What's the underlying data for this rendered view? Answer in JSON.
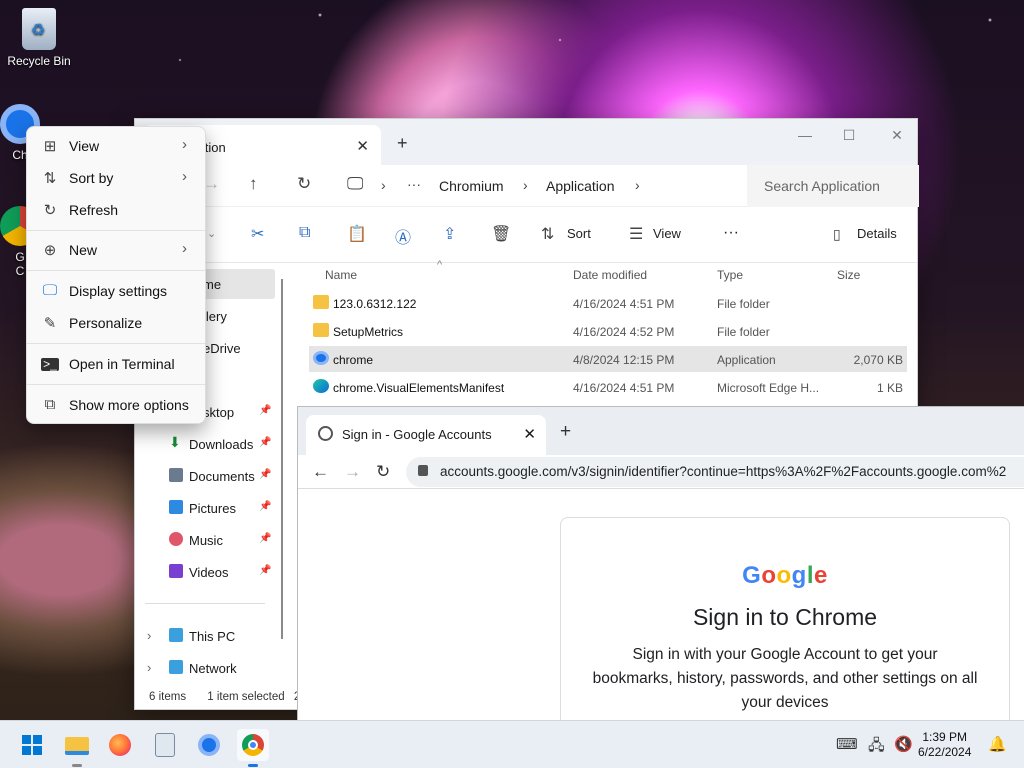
{
  "desktop": {
    "icons": [
      {
        "label": "Recycle Bin"
      },
      {
        "label": "Ch"
      },
      {
        "label": "G"
      },
      {
        "label": "C"
      }
    ]
  },
  "explorer": {
    "tab_title": "Application",
    "tab_title_visible": "cation",
    "breadcrumb": [
      "Chromium",
      "Application"
    ],
    "search_placeholder": "Search Application",
    "toolbar": {
      "sort": "Sort",
      "view": "View",
      "details": "Details"
    },
    "sidebar": [
      {
        "label": "me",
        "selected": true
      },
      {
        "label": "llery"
      },
      {
        "label": "eDrive"
      },
      {
        "label": "sktop",
        "pinned": true
      },
      {
        "label": "Downloads",
        "pinned": true
      },
      {
        "label": "Documents",
        "pinned": true
      },
      {
        "label": "Pictures",
        "pinned": true
      },
      {
        "label": "Music",
        "pinned": true
      },
      {
        "label": "Videos",
        "pinned": true
      },
      {
        "label": "This PC"
      },
      {
        "label": "Network"
      }
    ],
    "columns": [
      "Name",
      "Date modified",
      "Type",
      "Size"
    ],
    "rows": [
      {
        "name": "123.0.6312.122",
        "date": "4/16/2024 4:51 PM",
        "type": "File folder",
        "size": ""
      },
      {
        "name": "SetupMetrics",
        "date": "4/16/2024 4:52 PM",
        "type": "File folder",
        "size": ""
      },
      {
        "name": "chrome",
        "date": "4/8/2024 12:15 PM",
        "type": "Application",
        "size": "2,070 KB"
      },
      {
        "name": "chrome.VisualElementsManifest",
        "date": "4/16/2024 4:51 PM",
        "type": "Microsoft Edge H...",
        "size": "1 KB"
      }
    ],
    "status_items": "6 items",
    "status_selected": "1 item selected",
    "status_more": "2"
  },
  "chrome": {
    "tab_title": "Sign in - Google Accounts",
    "url": "accounts.google.com/v3/signin/identifier?continue=https%3A%2F%2Faccounts.google.com%2",
    "logo": "Google",
    "heading": "Sign in to Chrome",
    "body": "Sign in with your Google Account to get your bookmarks, history, passwords, and other settings on all your devices"
  },
  "context_menu": {
    "items": [
      "View",
      "Sort by",
      "Refresh",
      "New",
      "Display settings",
      "Personalize",
      "Open in Terminal",
      "Show more options"
    ]
  },
  "taskbar": {
    "time": "1:39 PM",
    "date": "6/22/2024"
  },
  "colors": {
    "accent": "#1a73e8",
    "folder": "#f5c242"
  }
}
